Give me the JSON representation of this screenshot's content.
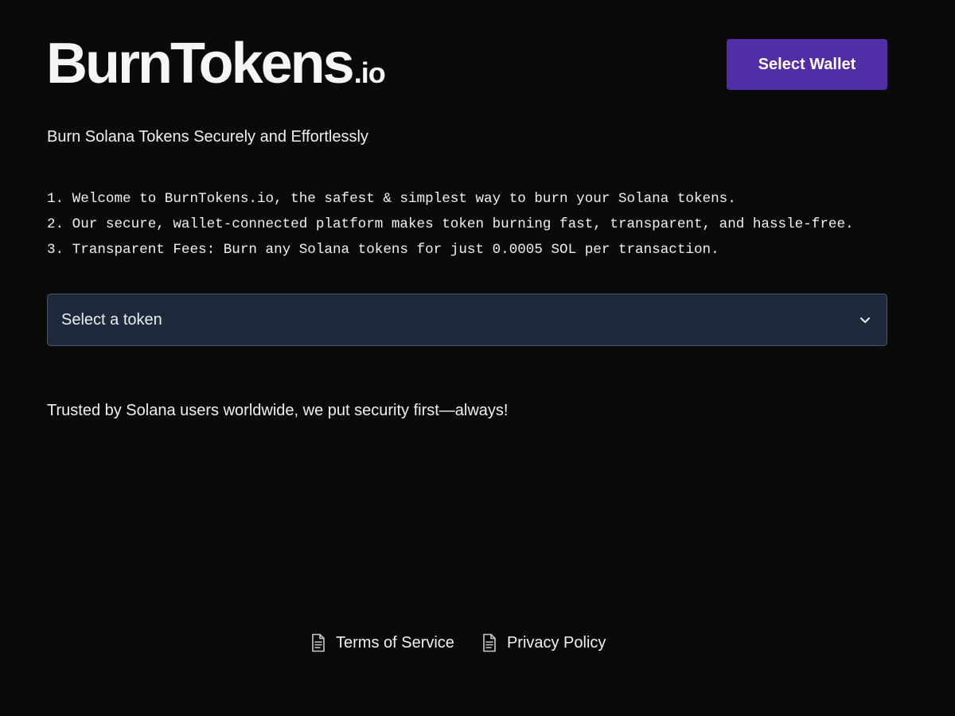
{
  "header": {
    "logo_main": "BurnTokens",
    "logo_suffix": ".io",
    "wallet_button_label": "Select Wallet"
  },
  "main": {
    "tagline": "Burn Solana Tokens Securely and Effortlessly",
    "steps": [
      "1. Welcome to BurnTokens.io, the safest & simplest way to burn your Solana tokens.",
      "2. Our secure, wallet-connected platform makes token burning fast, transparent, and hassle-free.",
      "3. Transparent Fees: Burn any Solana tokens for just 0.0005 SOL per transaction."
    ],
    "token_select_label": "Select a token",
    "trust_text": "Trusted by Solana users worldwide, we put security first—always!"
  },
  "footer": {
    "links": [
      {
        "label": "Terms of Service",
        "icon": "document-icon"
      },
      {
        "label": "Privacy Policy",
        "icon": "document-icon"
      }
    ]
  },
  "colors": {
    "background": "#0a0a0a",
    "wallet_button": "#512da8",
    "select_background": "#1e293b",
    "select_border": "#4b5563",
    "text": "#f0f0f0"
  }
}
